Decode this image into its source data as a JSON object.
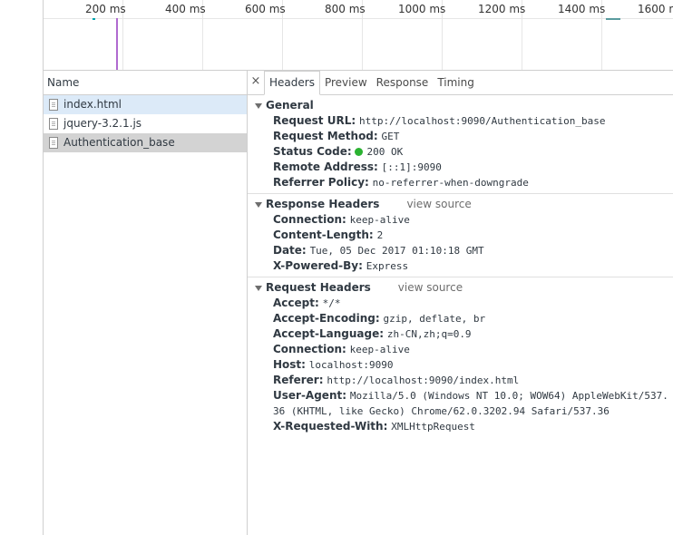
{
  "timeline": {
    "ticks": [
      "200 ms",
      "400 ms",
      "600 ms",
      "800 ms",
      "1000 ms",
      "1200 ms",
      "1400 ms",
      "1600 n"
    ]
  },
  "name_column": {
    "header": "Name",
    "items": [
      {
        "label": "index.html",
        "state": "selected"
      },
      {
        "label": "jquery-3.2.1.js",
        "state": "normal"
      },
      {
        "label": "Authentication_base",
        "state": "active"
      }
    ]
  },
  "tabs": {
    "close": "×",
    "items": [
      "Headers",
      "Preview",
      "Response",
      "Timing"
    ],
    "active": "Headers"
  },
  "general": {
    "title": "General",
    "rows": [
      {
        "key": "Request URL:",
        "value": "http://localhost:9090/Authentication_base"
      },
      {
        "key": "Request Method:",
        "value": "GET"
      },
      {
        "key": "Status Code:",
        "value": "200 OK"
      },
      {
        "key": "Remote Address:",
        "value": "[::1]:9090"
      },
      {
        "key": "Referrer Policy:",
        "value": "no-referrer-when-downgrade"
      }
    ]
  },
  "response_headers": {
    "title": "Response Headers",
    "view_source": "view source",
    "rows": [
      {
        "key": "Connection:",
        "value": "keep-alive"
      },
      {
        "key": "Content-Length:",
        "value": "2"
      },
      {
        "key": "Date:",
        "value": "Tue, 05 Dec 2017 01:10:18 GMT"
      },
      {
        "key": "X-Powered-By:",
        "value": "Express"
      }
    ]
  },
  "request_headers": {
    "title": "Request Headers",
    "view_source": "view source",
    "rows": [
      {
        "key": "Accept:",
        "value": "*/*"
      },
      {
        "key": "Accept-Encoding:",
        "value": "gzip, deflate, br"
      },
      {
        "key": "Accept-Language:",
        "value": "zh-CN,zh;q=0.9"
      },
      {
        "key": "Connection:",
        "value": "keep-alive"
      },
      {
        "key": "Host:",
        "value": "localhost:9090"
      },
      {
        "key": "Referer:",
        "value": "http://localhost:9090/index.html"
      },
      {
        "key": "User-Agent:",
        "value": "Mozilla/5.0 (Windows NT 10.0; WOW64) AppleWebKit/537.36 (KHTML, like Gecko) Chrome/62.0.3202.94 Safari/537.36"
      },
      {
        "key": "X-Requested-With:",
        "value": "XMLHttpRequest"
      }
    ]
  },
  "colors": {
    "status_ok": "#2bb231",
    "selected_row": "#dceaf8",
    "active_row": "#d3d3d3",
    "timeline_marker": "#b06ad0"
  }
}
